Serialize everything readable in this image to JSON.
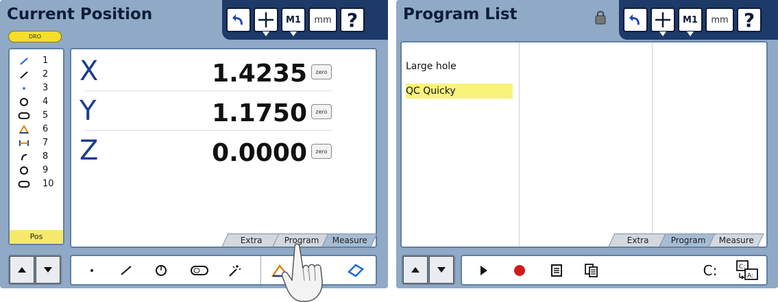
{
  "left_screen": {
    "title": "Current Position",
    "dro_badge": "DRO",
    "toolbar": {
      "m1_label": "M1",
      "units_label": "mm",
      "help_label": "?"
    },
    "features": [
      {
        "num": "1",
        "icon": "line-icon"
      },
      {
        "num": "2",
        "icon": "line-icon"
      },
      {
        "num": "3",
        "icon": "point-icon"
      },
      {
        "num": "4",
        "icon": "circle-icon"
      },
      {
        "num": "5",
        "icon": "slot-icon"
      },
      {
        "num": "6",
        "icon": "angle-icon"
      },
      {
        "num": "7",
        "icon": "distance-icon"
      },
      {
        "num": "8",
        "icon": "arc-icon"
      },
      {
        "num": "9",
        "icon": "circle-icon"
      },
      {
        "num": "10",
        "icon": "slot-icon"
      }
    ],
    "pos_tab": "Pos",
    "axes": [
      {
        "letter": "X",
        "value": "1.4235",
        "zero": "zero"
      },
      {
        "letter": "Y",
        "value": "1.1750",
        "zero": "zero"
      },
      {
        "letter": "Z",
        "value": "0.0000",
        "zero": "zero"
      }
    ],
    "tabs": [
      "Extra",
      "Program",
      "Measure"
    ],
    "active_tab": "Measure",
    "bottom_tools": [
      "point-icon",
      "line-icon",
      "circle-icon",
      "slot-icon",
      "auto-measure-icon",
      "angle-icon",
      "rectangle-icon"
    ]
  },
  "right_screen": {
    "title": "Program List",
    "toolbar": {
      "m1_label": "M1",
      "units_label": "mm",
      "help_label": "?"
    },
    "programs": [
      {
        "name": "Large hole",
        "selected": false
      },
      {
        "name": "QC Quicky",
        "selected": true
      }
    ],
    "tabs": [
      "Extra",
      "Program",
      "Measure"
    ],
    "active_tab": "Program",
    "drive_label": "C:",
    "bottom_tools": [
      "play-icon",
      "record-icon",
      "edit-icon",
      "copy-icon",
      "transfer-icon"
    ]
  },
  "colors": {
    "frame": "#8fa9c6",
    "toolbar": "#1e3a69",
    "highlight": "#f8f37a",
    "axis_letter": "#1d3d8c"
  }
}
